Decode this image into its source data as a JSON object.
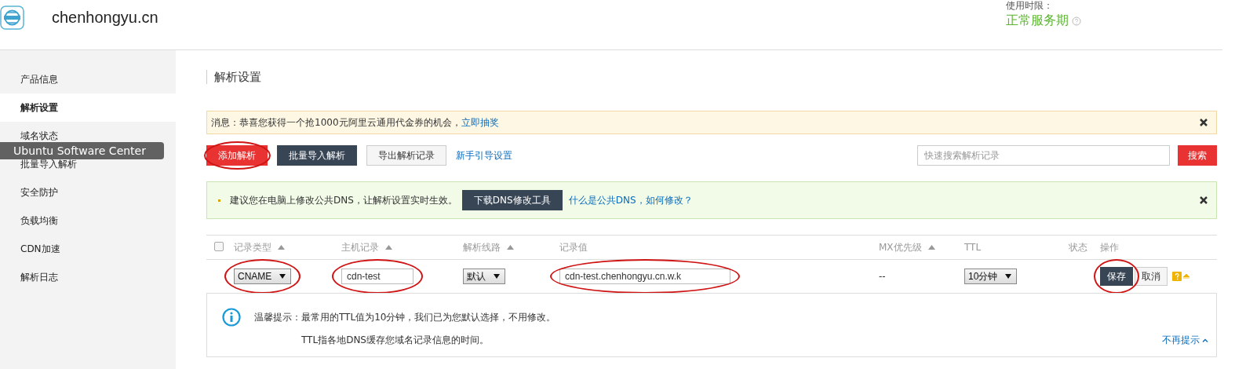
{
  "header": {
    "domain": "chenhongyu.cn",
    "term_label": "使用时限：",
    "term_status": "正常服务期"
  },
  "sidebar": {
    "items": [
      {
        "label": "产品信息",
        "selected": false
      },
      {
        "label": "解析设置",
        "selected": true
      },
      {
        "label": "域名状态",
        "selected": false
      },
      {
        "label": "批量导入解析",
        "selected": false
      },
      {
        "label": "安全防护",
        "selected": false
      },
      {
        "label": "负载均衡",
        "selected": false
      },
      {
        "label": "CDN加速",
        "selected": false
      },
      {
        "label": "解析日志",
        "selected": false
      }
    ]
  },
  "tooltip": "Ubuntu Software Center",
  "page_title": "解析设置",
  "message": {
    "text": "消息：恭喜您获得一个抢1000元阿里云通用代金券的机会，",
    "link": "立即抽奖"
  },
  "toolbar": {
    "buttons": [
      {
        "label": "添加解析",
        "kind": "primary",
        "circled": true
      },
      {
        "label": "批量导入解析",
        "kind": "dark",
        "circled": false
      },
      {
        "label": "导出解析记录",
        "kind": "plain",
        "circled": false
      }
    ],
    "link": "新手引导设置",
    "search": {
      "placeholder": "快速搜索解析记录"
    },
    "search_button": "搜索"
  },
  "dns_notice": {
    "text": "建议您在电脑上修改公共DNS，让解析设置实时生效。",
    "button": "下载DNS修改工具",
    "link": "什么是公共DNS，如何修改？"
  },
  "table": {
    "select_all": {
      "checked": false
    },
    "columns": [
      {
        "label": "记录类型",
        "sortable": true
      },
      {
        "label": "主机记录",
        "sortable": true
      },
      {
        "label": "解析线路",
        "sortable": true
      },
      {
        "label": "记录值",
        "sortable": false
      },
      {
        "label": "MX优先级",
        "sortable": true
      },
      {
        "label": "TTL",
        "sortable": false
      },
      {
        "label": "状态",
        "sortable": false
      },
      {
        "label": "操作",
        "sortable": false
      }
    ],
    "row": [
      {
        "kind": "select",
        "value": "CNAME",
        "circled": true
      },
      {
        "kind": "input",
        "value": "cdn-test",
        "circled": true
      },
      {
        "kind": "select",
        "value": "默认",
        "circled": false
      },
      {
        "kind": "input",
        "value": "cdn-test.chenhongyu.cn.w.k",
        "circled": true
      },
      {
        "kind": "text",
        "value": "--",
        "circled": false
      },
      {
        "kind": "select",
        "value": "10分钟",
        "circled": false
      },
      {
        "kind": "empty",
        "circled": false
      },
      {
        "kind": "actions",
        "save": "保存",
        "cancel": "取消",
        "circled": true
      }
    ]
  },
  "tip": {
    "label": "温馨提示：",
    "lines": [
      "最常用的TTL值为10分钟，我们已为您默认选择，不用修改。",
      "TTL指各地DNS缓存您域名记录信息的时间。"
    ],
    "dismiss": "不再提示"
  }
}
